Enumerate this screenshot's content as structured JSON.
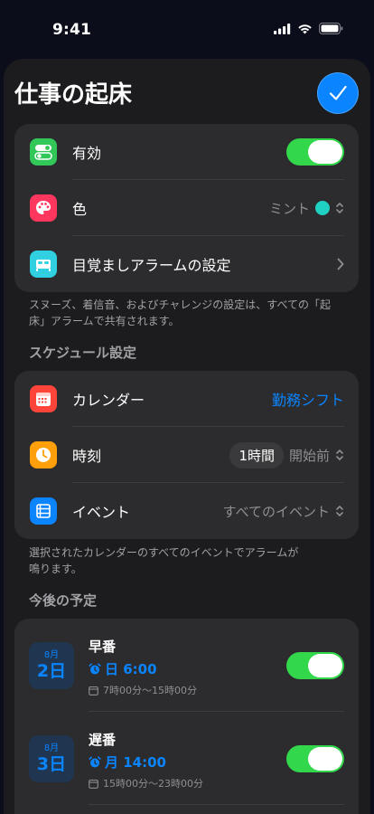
{
  "status": {
    "time": "9:41"
  },
  "header": {
    "title": "仕事の起床"
  },
  "settings": {
    "enabled_label": "有効",
    "color_label": "色",
    "color_value": "ミント",
    "alarm_settings_label": "目覚ましアラームの設定"
  },
  "settings_footnote": "スヌーズ、着信音、およびチャレンジの設定は、すべての「起床」アラームで共有されます。",
  "schedule": {
    "section_title": "スケジュール設定",
    "calendar_label": "カレンダー",
    "calendar_value": "勤務シフト",
    "time_label": "時刻",
    "time_offset": "1時間",
    "time_relation": "開始前",
    "event_label": "イベント",
    "event_value": "すべてのイベント"
  },
  "schedule_footnote": "選択されたカレンダーのすべてのイベントでアラームが鳴ります。",
  "upcoming": {
    "section_title": "今後の予定",
    "items": [
      {
        "month": "8月",
        "day": "2日",
        "title": "早番",
        "alarm": "日 6:00",
        "range": "7時00分〜15時00分"
      },
      {
        "month": "8月",
        "day": "3日",
        "title": "遅番",
        "alarm": "月 14:00",
        "range": "15時00分〜23時00分"
      }
    ]
  },
  "colors": {
    "accent": "#0a84ff",
    "toggle_on": "#32d74b",
    "mint": "#1fd1c1"
  }
}
